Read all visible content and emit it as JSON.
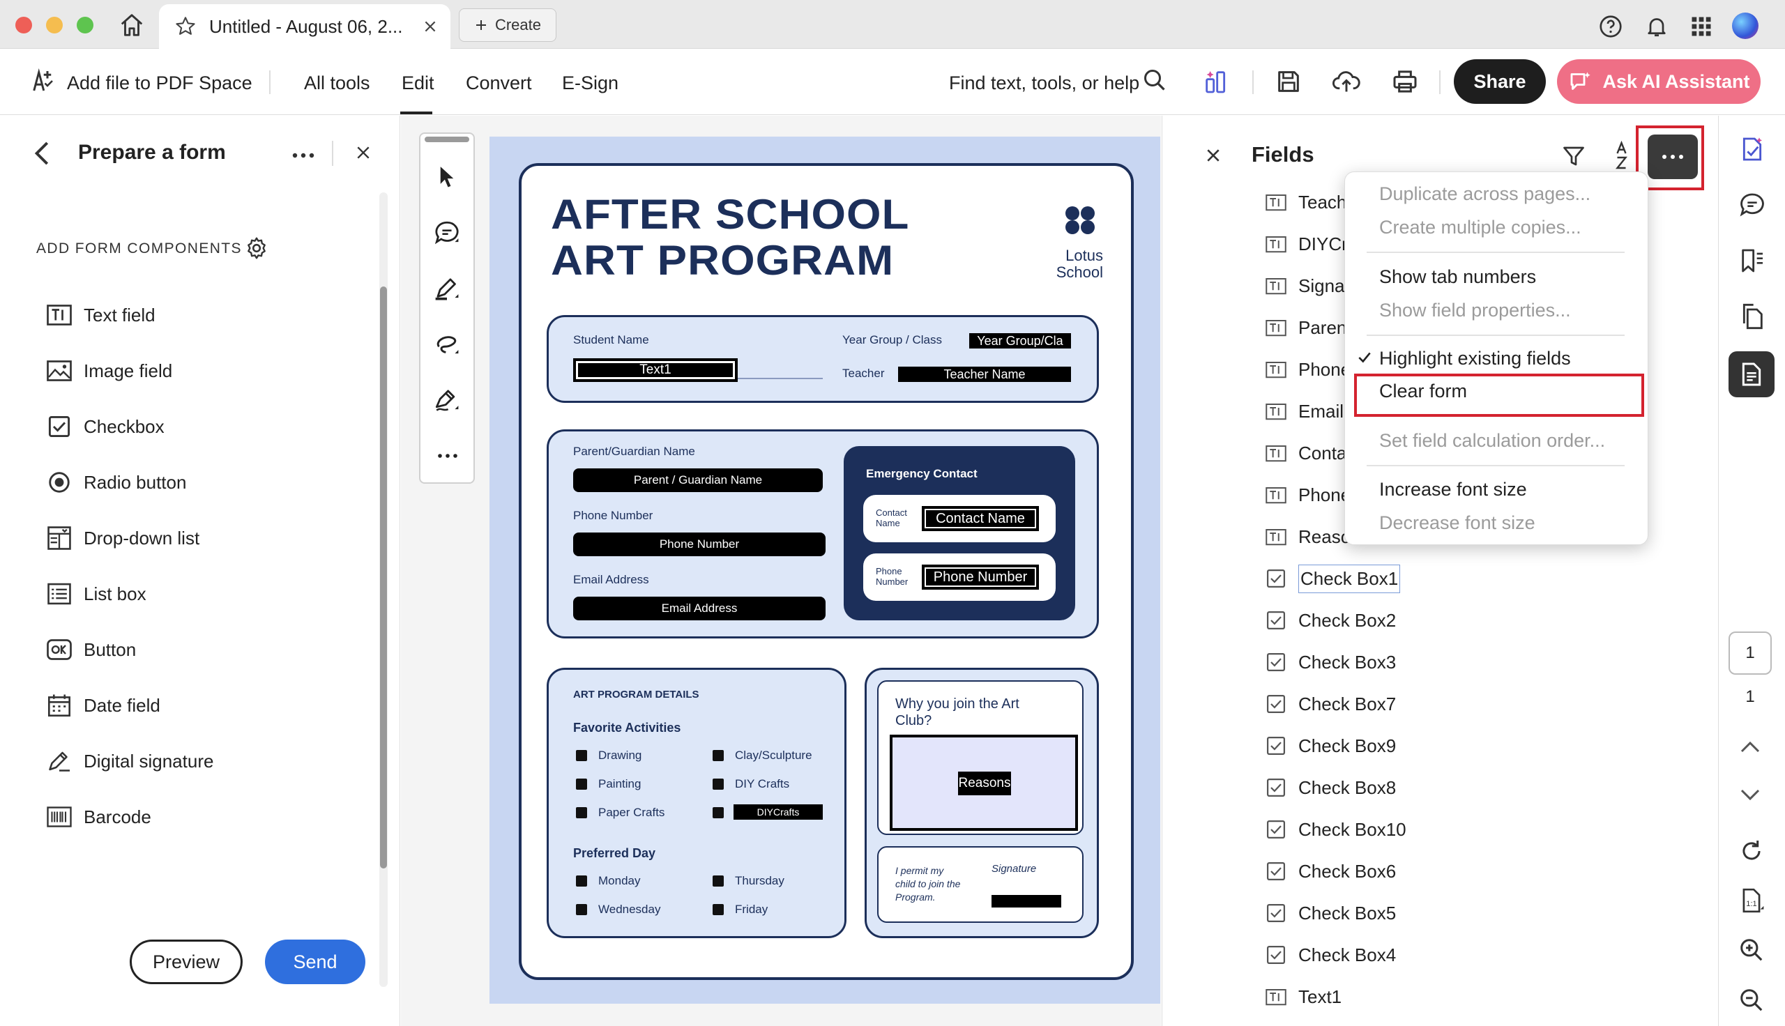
{
  "tab": {
    "title": "Untitled - August 06, 2...",
    "create_label": "Create"
  },
  "toolbar": {
    "add_file": "Add file to PDF Space",
    "menu": [
      "All tools",
      "Edit",
      "Convert",
      "E-Sign"
    ],
    "find": "Find text, tools, or help",
    "share": "Share",
    "ai": "Ask AI Assistant"
  },
  "left_panel": {
    "title": "Prepare a form",
    "section": "ADD FORM COMPONENTS",
    "items": [
      "Text field",
      "Image field",
      "Checkbox",
      "Radio button",
      "Drop-down list",
      "List box",
      "Button",
      "Date field",
      "Digital signature",
      "Barcode"
    ],
    "preview": "Preview",
    "send": "Send"
  },
  "document": {
    "title_line1": "AFTER SCHOOL",
    "title_line2": "ART PROGRAM",
    "school_line1": "Lotus",
    "school_line2": "School",
    "student_name_label": "Student Name",
    "student_name_field": "Text1",
    "year_group_label": "Year Group / Class",
    "year_group_field": "Year Group/Cla",
    "teacher_label": "Teacher",
    "teacher_field": "Teacher Name",
    "parent_label": "Parent/Guardian Name",
    "parent_field": "Parent / Guardian Name",
    "phone_label": "Phone Number",
    "phone_field": "Phone Number",
    "email_label": "Email Address",
    "email_field": "Email Address",
    "emergency_title": "Emergency Contact",
    "contact_name_label": "Contact Name",
    "contact_name_field": "Contact Name",
    "phone_number_label": "Phone Number",
    "phone_number_field": "Phone Number",
    "details_title": "ART PROGRAM DETAILS",
    "favorite_title": "Favorite Activities",
    "activities": [
      "Drawing",
      "Painting",
      "Paper Crafts",
      "Clay/Sculpture",
      "DIY Crafts"
    ],
    "diy_field": "DIYCrafts",
    "preferred_title": "Preferred Day",
    "days": [
      "Monday",
      "Wednesday",
      "Thursday",
      "Friday"
    ],
    "why_label": "Why you join the Art Club?",
    "reasons_field": "Reasons",
    "permit_text": "I permit my child to join the Program.",
    "signature_label": "Signature",
    "signature_field": "Signature"
  },
  "fields_panel": {
    "title": "Fields",
    "items": [
      "Teacher",
      "DIYCrafts",
      "Signature",
      "Parent",
      "Phone",
      "Email",
      "Contact",
      "Phone",
      "Reasons",
      "Check Box1",
      "Check Box2",
      "Check Box3",
      "Check Box7",
      "Check Box9",
      "Check Box8",
      "Check Box10",
      "Check Box6",
      "Check Box5",
      "Check Box4",
      "Text1"
    ]
  },
  "more_menu": {
    "items": [
      {
        "label": "Duplicate across pages...",
        "enabled": false
      },
      {
        "label": "Create multiple copies...",
        "enabled": false
      },
      {
        "label": "Show tab numbers",
        "enabled": true
      },
      {
        "label": "Show field properties...",
        "enabled": false
      },
      {
        "label": "Highlight existing fields",
        "enabled": true,
        "checked": true
      },
      {
        "label": "Clear form",
        "enabled": true
      },
      {
        "label": "Set field calculation order...",
        "enabled": false
      },
      {
        "label": "Increase font size",
        "enabled": true
      },
      {
        "label": "Decrease font size",
        "enabled": false
      }
    ]
  },
  "page_nav": {
    "current": "1",
    "total": "1"
  },
  "colors": {
    "accent_blue": "#2f6fde",
    "ai_pink": "#ef6f86",
    "navy": "#1c2f5a",
    "highlight_red": "#d4232f"
  }
}
